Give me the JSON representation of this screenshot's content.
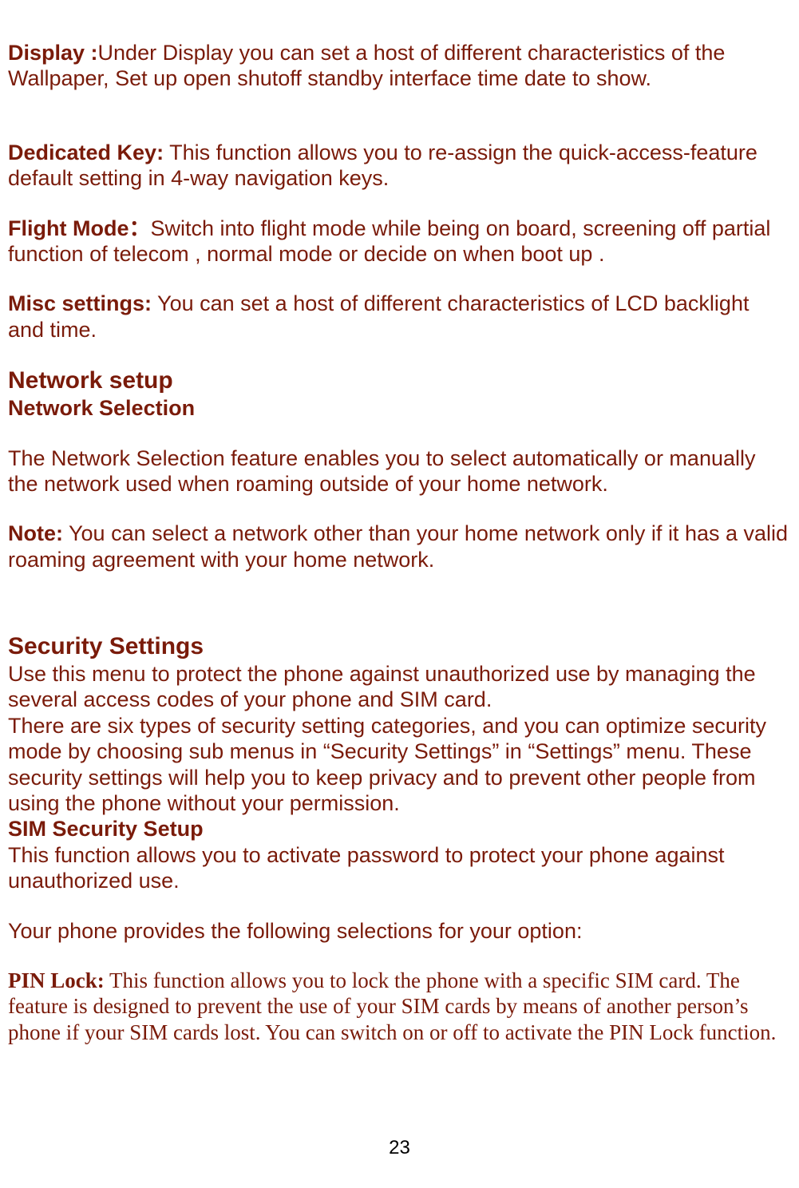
{
  "display": {
    "label": "Display :",
    "text": "Under Display you can set a host of different characteristics of the Wallpaper, Set up open shutoff standby interface time date to show."
  },
  "dedicated_key": {
    "label": "Dedicated Key:",
    "text": " This function allows you to re-assign the quick-access-feature default setting in 4-way navigation keys."
  },
  "flight_mode": {
    "label": "Flight Mode：",
    "text": "Switch into flight mode while being on board, screening off partial function of telecom , normal mode or decide on when boot up ."
  },
  "misc_settings": {
    "label": "Misc settings:",
    "text": " You can set a host of different characteristics of  LCD backlight and time."
  },
  "network_setup": {
    "heading": "Network setup",
    "sub": "Network Selection",
    "desc": "The Network Selection feature enables you to select automatically or manually the network used when roaming outside of your home network.",
    "note_label": "Note:",
    "note_text": " You can select a network other than your home network only if it has a valid roaming agreement with your home network."
  },
  "security": {
    "heading": "Security Settings",
    "intro": "Use this menu to protect the phone against unauthorized use by managing the several access codes of your phone and SIM card.",
    "body": "There are six types of security setting categories, and you can optimize security mode by choosing sub menus in “Security Settings” in “Settings” menu. These security settings will help you to keep privacy and to prevent other people from using the phone without your permission.",
    "sim_heading": "SIM Security Setup",
    "sim_text": "This function allows you to activate password to protect your phone against unauthorized use.",
    "options_intro": "Your phone provides the following selections for your option:",
    "pin_label": "PIN Lock:",
    "pin_text": " This function allows you to lock the phone with a specific SIM card. The feature is designed to prevent the use of your SIM cards by means of another person’s phone if your SIM cards lost. You can switch on or off to activate the PIN Lock function."
  },
  "page_number": "23"
}
